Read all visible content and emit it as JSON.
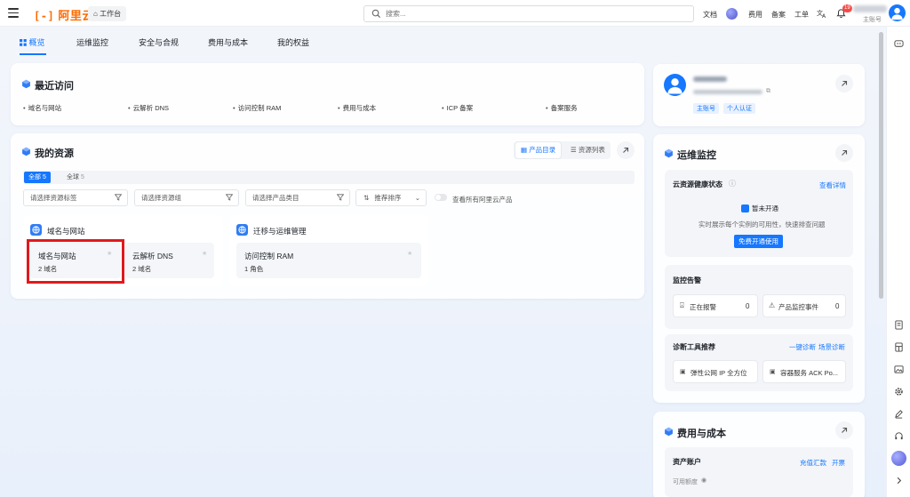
{
  "header": {
    "logo": "阿里云",
    "workbench": "工作台",
    "search_placeholder": "搜索...",
    "links": [
      "文档",
      "费用",
      "备案",
      "工单"
    ],
    "notification_count": "19",
    "account_label": "主账号"
  },
  "nav": {
    "tabs": [
      "概览",
      "运维监控",
      "安全与合规",
      "费用与成本",
      "我的权益"
    ]
  },
  "recent": {
    "title": "最近访问",
    "items": [
      "域名与网站",
      "云解析 DNS",
      "访问控制 RAM",
      "费用与成本",
      "ICP 备案",
      "备案服务"
    ]
  },
  "resources": {
    "title": "我的资源",
    "view_catalog": "产品目录",
    "view_list": "资源列表",
    "scope_all": "全部",
    "scope_all_count": "5",
    "scope_global": "全球",
    "scope_global_count": "5",
    "filters": [
      "请选择资源标签",
      "请选择资源组",
      "请选择产品类目"
    ],
    "sort_label": "推荐排序",
    "toggle_label": "查看所有阿里云产品",
    "groups": [
      {
        "title": "域名与网站",
        "items": [
          {
            "name": "域名与网站",
            "meta": "2 域名"
          },
          {
            "name": "云解析 DNS",
            "meta": "2 域名"
          }
        ]
      },
      {
        "title": "迁移与运维管理",
        "items": [
          {
            "name": "访问控制 RAM",
            "meta": "1 角色"
          }
        ]
      }
    ]
  },
  "profile": {
    "account_type": "主账号",
    "verify": "个人认证"
  },
  "monitor": {
    "title": "运维监控",
    "health_title": "云资源健康状态",
    "health_link": "查看详情",
    "health_status": "暂未开通",
    "health_desc": "实时展示每个实例的可用性，快速排查问题",
    "health_button": "免费开通使用",
    "alarm_title": "监控告警",
    "alarm_items": [
      {
        "label": "正在报警",
        "value": "0"
      },
      {
        "label": "产品监控事件",
        "value": "0"
      }
    ],
    "diag_title": "诊断工具推荐",
    "diag_link1": "一键诊断",
    "diag_link2": "场景诊断",
    "diag_items": [
      "弹性公网 IP 全方位",
      "容器服务 ACK Po..."
    ]
  },
  "cost": {
    "title": "费用与成本",
    "asset_title": "资产账户",
    "asset_link1": "充值汇款",
    "asset_link2": "开票",
    "available_label": "可用额度"
  }
}
